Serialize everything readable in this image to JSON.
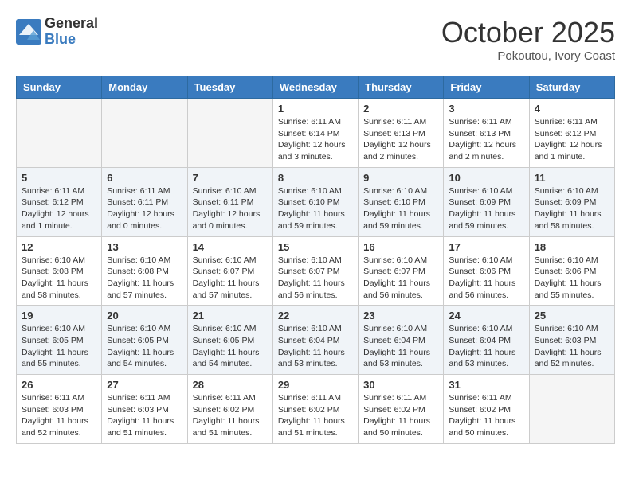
{
  "logo": {
    "general": "General",
    "blue": "Blue"
  },
  "title": "October 2025",
  "location": "Pokoutou, Ivory Coast",
  "weekdays": [
    "Sunday",
    "Monday",
    "Tuesday",
    "Wednesday",
    "Thursday",
    "Friday",
    "Saturday"
  ],
  "weeks": [
    [
      {
        "day": "",
        "info": ""
      },
      {
        "day": "",
        "info": ""
      },
      {
        "day": "",
        "info": ""
      },
      {
        "day": "1",
        "info": "Sunrise: 6:11 AM\nSunset: 6:14 PM\nDaylight: 12 hours and 3 minutes."
      },
      {
        "day": "2",
        "info": "Sunrise: 6:11 AM\nSunset: 6:13 PM\nDaylight: 12 hours and 2 minutes."
      },
      {
        "day": "3",
        "info": "Sunrise: 6:11 AM\nSunset: 6:13 PM\nDaylight: 12 hours and 2 minutes."
      },
      {
        "day": "4",
        "info": "Sunrise: 6:11 AM\nSunset: 6:12 PM\nDaylight: 12 hours and 1 minute."
      }
    ],
    [
      {
        "day": "5",
        "info": "Sunrise: 6:11 AM\nSunset: 6:12 PM\nDaylight: 12 hours and 1 minute."
      },
      {
        "day": "6",
        "info": "Sunrise: 6:11 AM\nSunset: 6:11 PM\nDaylight: 12 hours and 0 minutes."
      },
      {
        "day": "7",
        "info": "Sunrise: 6:10 AM\nSunset: 6:11 PM\nDaylight: 12 hours and 0 minutes."
      },
      {
        "day": "8",
        "info": "Sunrise: 6:10 AM\nSunset: 6:10 PM\nDaylight: 11 hours and 59 minutes."
      },
      {
        "day": "9",
        "info": "Sunrise: 6:10 AM\nSunset: 6:10 PM\nDaylight: 11 hours and 59 minutes."
      },
      {
        "day": "10",
        "info": "Sunrise: 6:10 AM\nSunset: 6:09 PM\nDaylight: 11 hours and 59 minutes."
      },
      {
        "day": "11",
        "info": "Sunrise: 6:10 AM\nSunset: 6:09 PM\nDaylight: 11 hours and 58 minutes."
      }
    ],
    [
      {
        "day": "12",
        "info": "Sunrise: 6:10 AM\nSunset: 6:08 PM\nDaylight: 11 hours and 58 minutes."
      },
      {
        "day": "13",
        "info": "Sunrise: 6:10 AM\nSunset: 6:08 PM\nDaylight: 11 hours and 57 minutes."
      },
      {
        "day": "14",
        "info": "Sunrise: 6:10 AM\nSunset: 6:07 PM\nDaylight: 11 hours and 57 minutes."
      },
      {
        "day": "15",
        "info": "Sunrise: 6:10 AM\nSunset: 6:07 PM\nDaylight: 11 hours and 56 minutes."
      },
      {
        "day": "16",
        "info": "Sunrise: 6:10 AM\nSunset: 6:07 PM\nDaylight: 11 hours and 56 minutes."
      },
      {
        "day": "17",
        "info": "Sunrise: 6:10 AM\nSunset: 6:06 PM\nDaylight: 11 hours and 56 minutes."
      },
      {
        "day": "18",
        "info": "Sunrise: 6:10 AM\nSunset: 6:06 PM\nDaylight: 11 hours and 55 minutes."
      }
    ],
    [
      {
        "day": "19",
        "info": "Sunrise: 6:10 AM\nSunset: 6:05 PM\nDaylight: 11 hours and 55 minutes."
      },
      {
        "day": "20",
        "info": "Sunrise: 6:10 AM\nSunset: 6:05 PM\nDaylight: 11 hours and 54 minutes."
      },
      {
        "day": "21",
        "info": "Sunrise: 6:10 AM\nSunset: 6:05 PM\nDaylight: 11 hours and 54 minutes."
      },
      {
        "day": "22",
        "info": "Sunrise: 6:10 AM\nSunset: 6:04 PM\nDaylight: 11 hours and 53 minutes."
      },
      {
        "day": "23",
        "info": "Sunrise: 6:10 AM\nSunset: 6:04 PM\nDaylight: 11 hours and 53 minutes."
      },
      {
        "day": "24",
        "info": "Sunrise: 6:10 AM\nSunset: 6:04 PM\nDaylight: 11 hours and 53 minutes."
      },
      {
        "day": "25",
        "info": "Sunrise: 6:10 AM\nSunset: 6:03 PM\nDaylight: 11 hours and 52 minutes."
      }
    ],
    [
      {
        "day": "26",
        "info": "Sunrise: 6:11 AM\nSunset: 6:03 PM\nDaylight: 11 hours and 52 minutes."
      },
      {
        "day": "27",
        "info": "Sunrise: 6:11 AM\nSunset: 6:03 PM\nDaylight: 11 hours and 51 minutes."
      },
      {
        "day": "28",
        "info": "Sunrise: 6:11 AM\nSunset: 6:02 PM\nDaylight: 11 hours and 51 minutes."
      },
      {
        "day": "29",
        "info": "Sunrise: 6:11 AM\nSunset: 6:02 PM\nDaylight: 11 hours and 51 minutes."
      },
      {
        "day": "30",
        "info": "Sunrise: 6:11 AM\nSunset: 6:02 PM\nDaylight: 11 hours and 50 minutes."
      },
      {
        "day": "31",
        "info": "Sunrise: 6:11 AM\nSunset: 6:02 PM\nDaylight: 11 hours and 50 minutes."
      },
      {
        "day": "",
        "info": ""
      }
    ]
  ]
}
